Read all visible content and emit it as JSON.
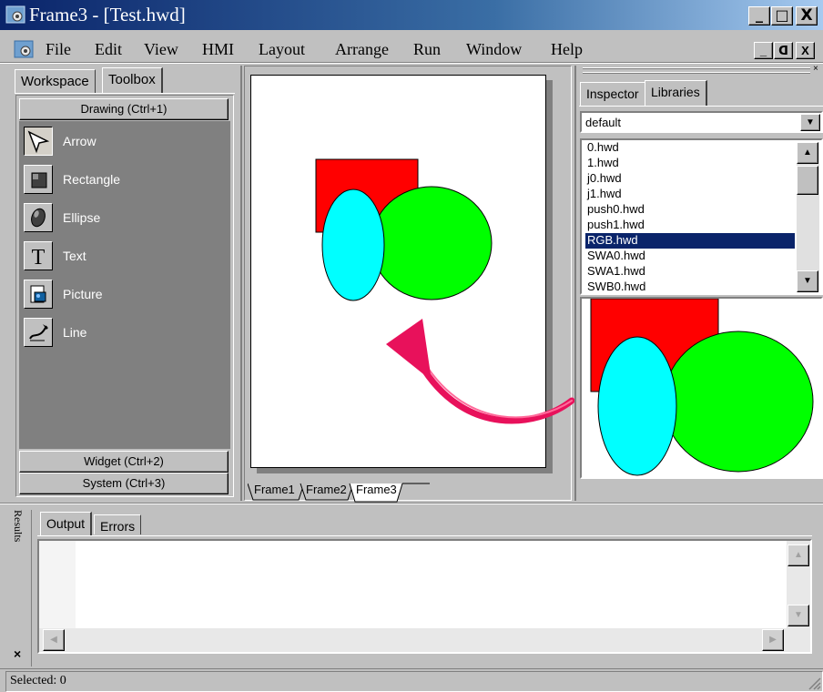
{
  "window": {
    "title": "Frame3 - [Test.hwd]",
    "minimize_glyph": "_",
    "maximize_glyph": "□",
    "close_glyph": "X"
  },
  "menu": {
    "items": [
      "File",
      "Edit",
      "View",
      "HMI",
      "Layout",
      "Arrange",
      "Run",
      "Window",
      "Help"
    ],
    "mdi_minimize": "_",
    "mdi_restore": "ᗡ",
    "mdi_close": "X"
  },
  "left_panel": {
    "tabs": [
      "Workspace",
      "Toolbox"
    ],
    "active_tab": "Toolbox",
    "sections": {
      "drawing": "Drawing (Ctrl+1)",
      "widget": "Widget (Ctrl+2)",
      "system": "System (Ctrl+3)"
    },
    "tools": [
      {
        "label": "Arrow",
        "icon": "arrow-cursor-icon",
        "selected": true
      },
      {
        "label": "Rectangle",
        "icon": "rectangle-icon",
        "selected": false
      },
      {
        "label": "Ellipse",
        "icon": "ellipse-icon",
        "selected": false
      },
      {
        "label": "Text",
        "icon": "text-icon",
        "selected": false
      },
      {
        "label": "Picture",
        "icon": "picture-icon",
        "selected": false
      },
      {
        "label": "Line",
        "icon": "line-icon",
        "selected": false
      }
    ]
  },
  "design": {
    "frame_tabs": [
      "Frame1",
      "Frame2",
      "Frame3"
    ],
    "active_frame": "Frame3",
    "shape_colors": {
      "rect": "#ff0000",
      "big_ellipse": "#00ff00",
      "small_ellipse": "#00ffff"
    },
    "annotation_arrow_color": "#e8115b"
  },
  "right_panel": {
    "tabs": [
      "Inspector",
      "Libraries"
    ],
    "active_tab": "Libraries",
    "library_combo": "default",
    "library_items": [
      "0.hwd",
      "1.hwd",
      "j0.hwd",
      "j1.hwd",
      "push0.hwd",
      "push1.hwd",
      "RGB.hwd",
      "SWA0.hwd",
      "SWA1.hwd",
      "SWB0.hwd"
    ],
    "selected_item": "RGB.hwd"
  },
  "results": {
    "panel_label": "Results",
    "tabs": [
      "Output",
      "Errors"
    ],
    "active_tab": "Output"
  },
  "status": {
    "text": "Selected: 0"
  }
}
